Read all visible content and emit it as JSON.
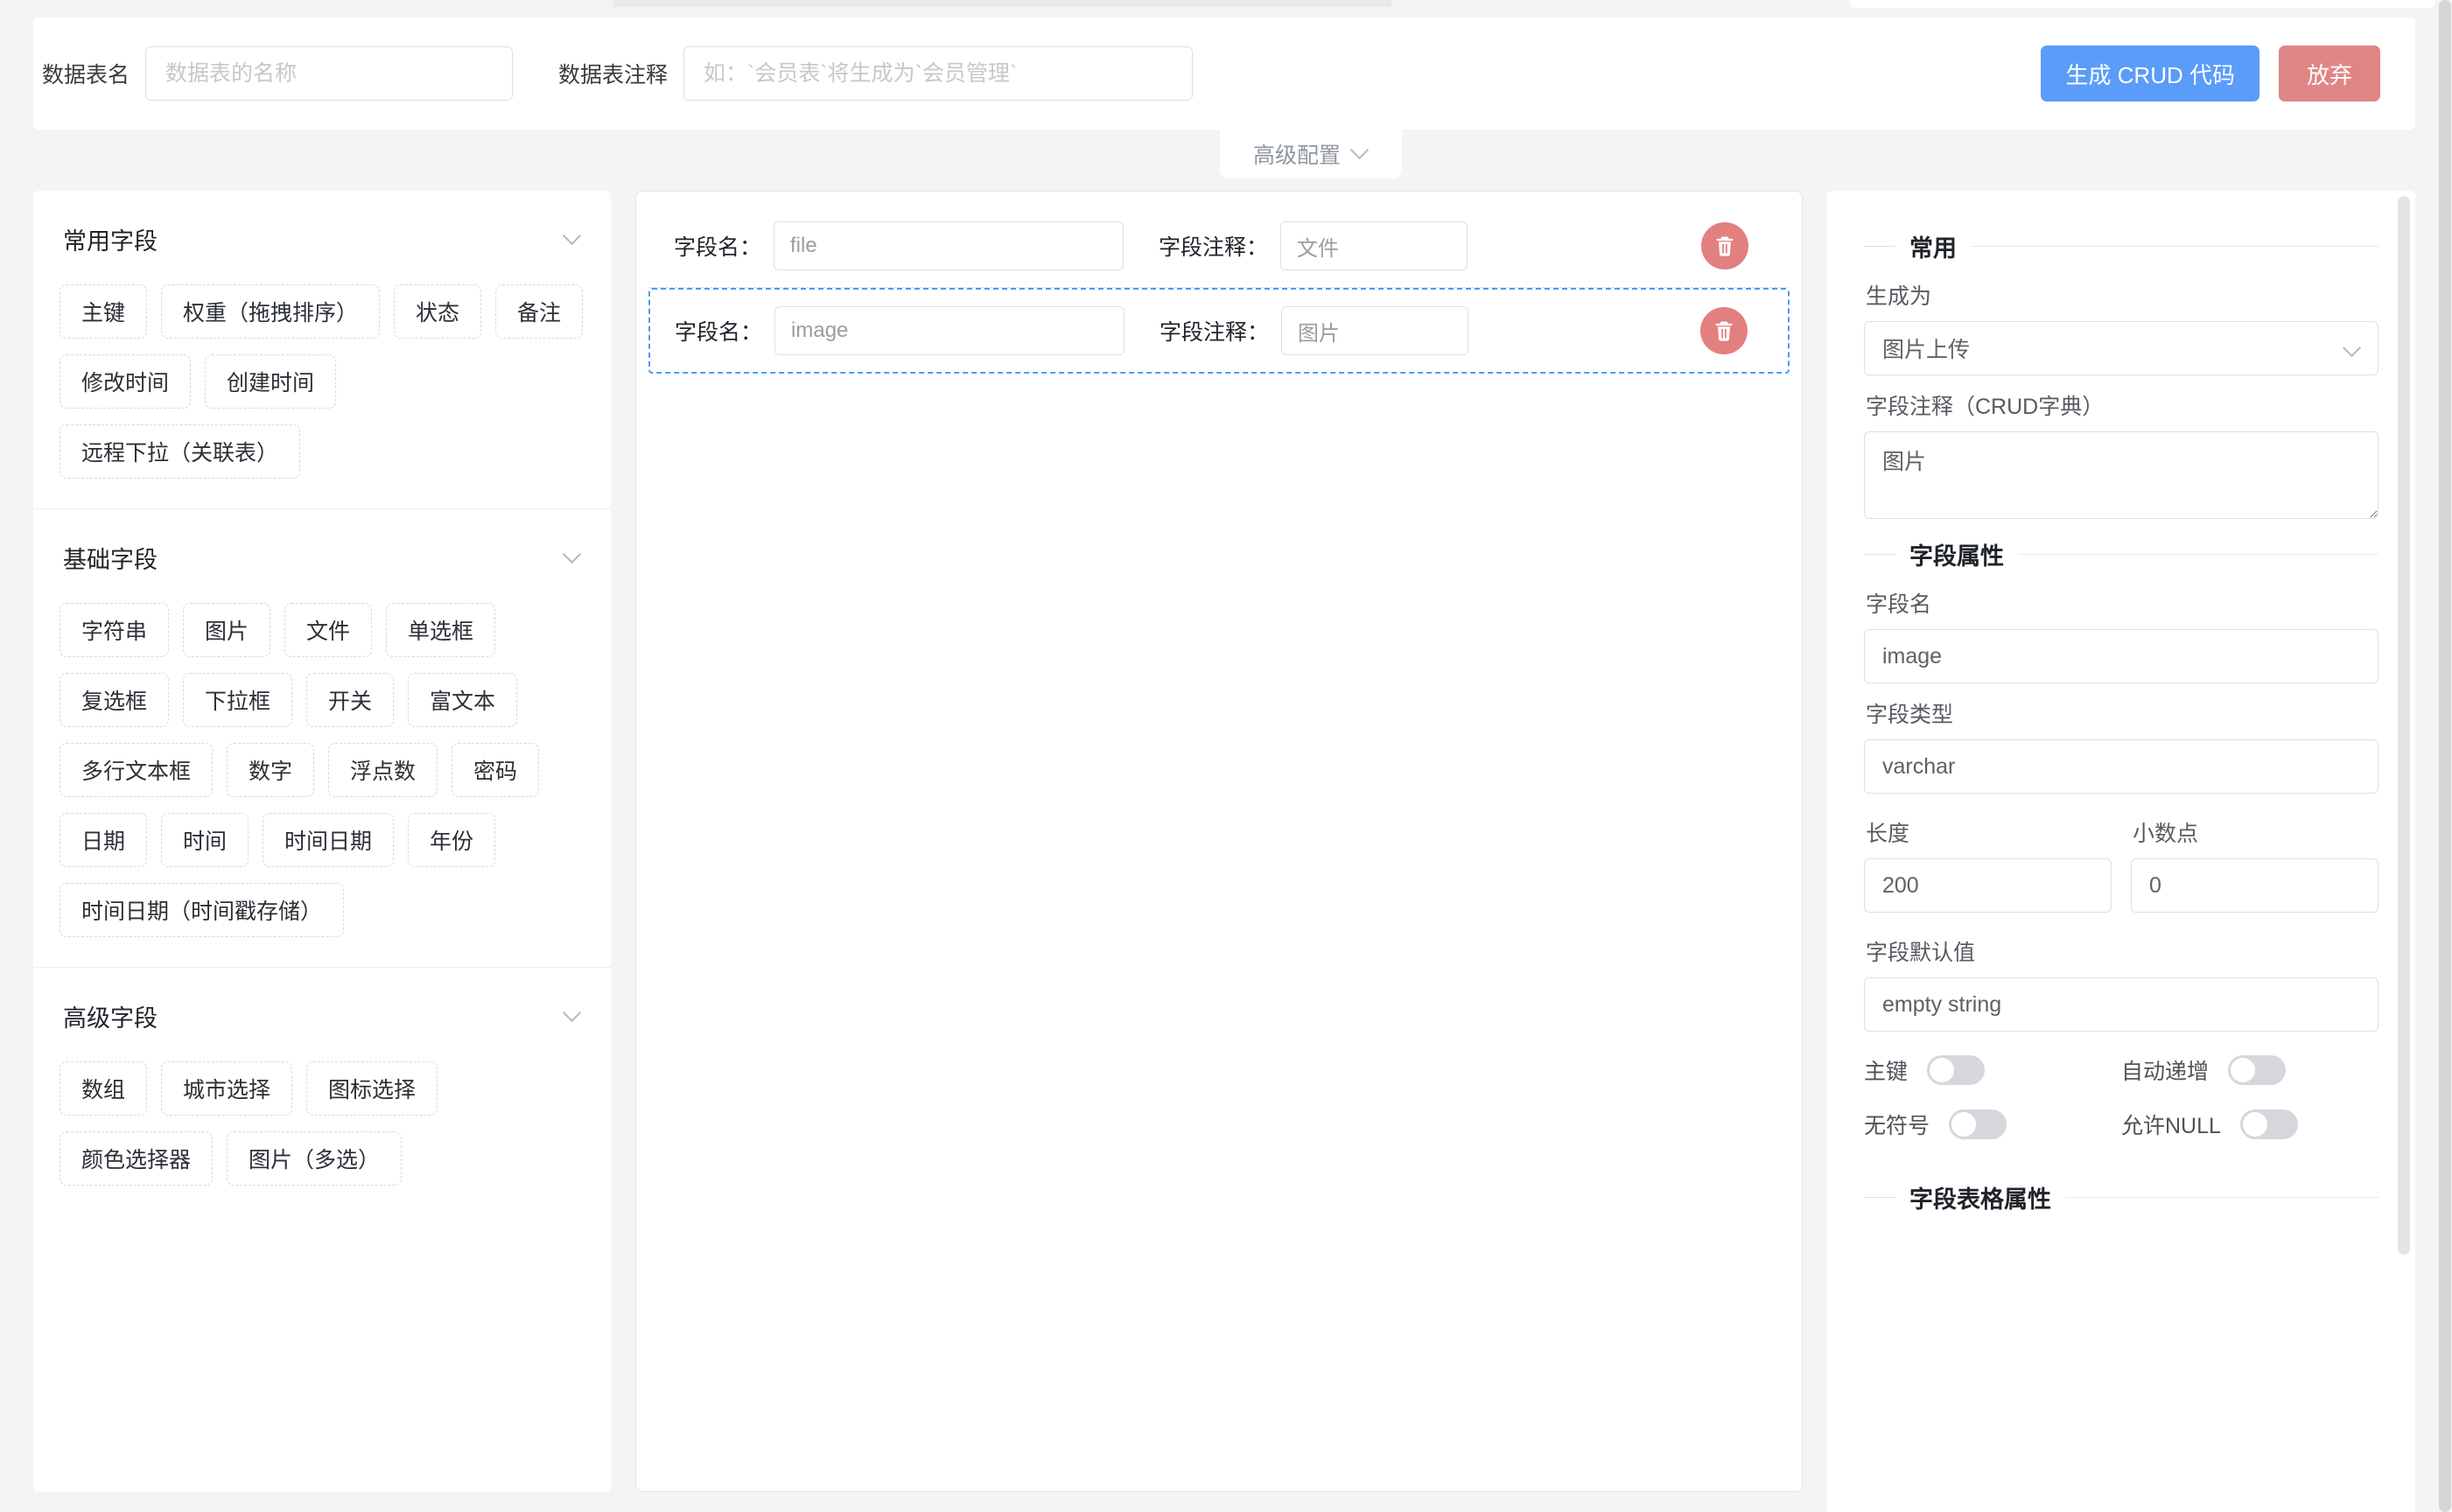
{
  "header": {
    "table_name_label": "数据表名",
    "table_name_value": "",
    "table_name_placeholder": "数据表的名称",
    "table_comment_label": "数据表注释",
    "table_comment_value": "",
    "table_comment_placeholder": "如：`会员表`将生成为`会员管理`",
    "generate_button": "生成 CRUD 代码",
    "cancel_button": "放弃",
    "primary_color": "#5a9cf8",
    "danger_color": "#e08585"
  },
  "advanced_config": {
    "label": "高级配置",
    "icon": "chevron-down-icon"
  },
  "palette": {
    "groups": [
      {
        "title": "常用字段",
        "chips": [
          "主键",
          "权重（拖拽排序）",
          "状态",
          "备注",
          "修改时间",
          "创建时间",
          "远程下拉（关联表）"
        ]
      },
      {
        "title": "基础字段",
        "chips": [
          "字符串",
          "图片",
          "文件",
          "单选框",
          "复选框",
          "下拉框",
          "开关",
          "富文本",
          "多行文本框",
          "数字",
          "浮点数",
          "密码",
          "日期",
          "时间",
          "时间日期",
          "年份",
          "时间日期（时间戳存储）"
        ]
      },
      {
        "title": "高级字段",
        "chips": [
          "数组",
          "城市选择",
          "图标选择",
          "颜色选择器",
          "图片（多选）"
        ]
      }
    ]
  },
  "canvas": {
    "field_name_label": "字段名：",
    "field_comment_label": "字段注释：",
    "delete_icon": "trash-icon",
    "rows": [
      {
        "name": "file",
        "comment": "文件",
        "selected": false
      },
      {
        "name": "image",
        "comment": "图片",
        "selected": true
      }
    ],
    "selected_border_color": "#4a9bf5",
    "delete_button_color": "#e2807f"
  },
  "inspector": {
    "section_common": "常用",
    "generate_as_label": "生成为",
    "generate_as_value": "图片上传",
    "comment_dict_label": "字段注释（CRUD字典）",
    "comment_dict_value": "图片",
    "section_field_attrs": "字段属性",
    "field_name_label": "字段名",
    "field_name_value": "image",
    "field_type_label": "字段类型",
    "field_type_value": "varchar",
    "length_label": "长度",
    "length_value": "200",
    "decimal_label": "小数点",
    "decimal_value": "0",
    "default_label": "字段默认值",
    "default_value": "empty string",
    "switches": [
      {
        "label": "主键",
        "on": false
      },
      {
        "label": "自动递增",
        "on": false
      },
      {
        "label": "无符号",
        "on": false
      },
      {
        "label": "允许NULL",
        "on": false
      }
    ],
    "section_table_attrs": "字段表格属性"
  }
}
